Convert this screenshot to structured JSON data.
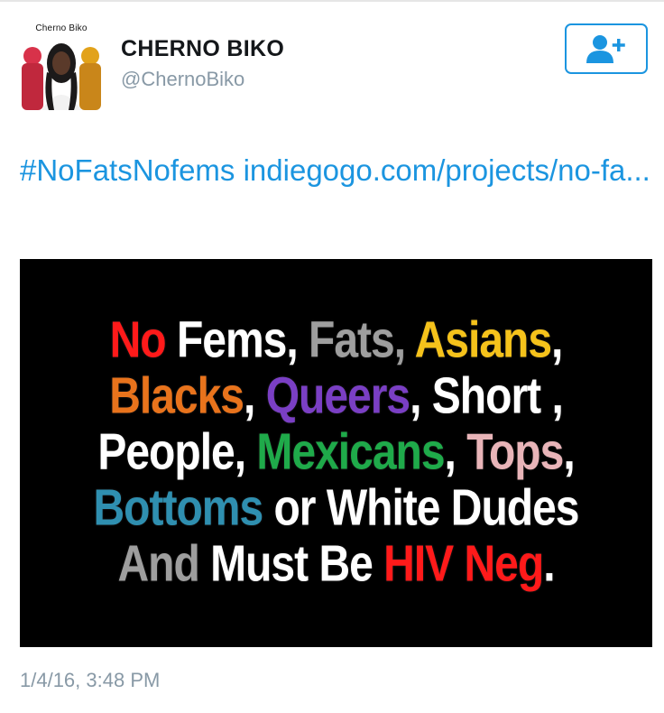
{
  "author": {
    "avatar_caption": "Cherno Biko",
    "display_name": "CHERNO BIKO",
    "handle": "@ChernoBiko"
  },
  "follow_icon": "add-user-icon",
  "tweet": {
    "hashtag": "#NoFatsNofems",
    "link": "indiegogo.com/projects/no-fa...",
    "timestamp": "1/4/16, 3:48 PM"
  },
  "media_text": {
    "line1": {
      "w1": "No",
      "w2": "Fems,",
      "w3": "Fats,",
      "w4": "Asians",
      "w5": ","
    },
    "line2": {
      "w1": "Blacks",
      "w2": ",",
      "w3": "Queers",
      "w4": ", Short ,"
    },
    "line3": {
      "w1": "People,",
      "w2": "Mexicans",
      "w3": ",",
      "w4": "Tops",
      "w5": ","
    },
    "line4": {
      "w1": "Bottoms",
      "w2": "or White Dudes"
    },
    "line5": {
      "w1": "And",
      "w2": "Must Be",
      "w3": "HIV Neg",
      "w4": "."
    }
  },
  "colors": {
    "link": "#1b95e0",
    "red": "#ff1a1a",
    "gray": "#9e9e9e",
    "yellow": "#f5c21b",
    "orange": "#e8731c",
    "purple": "#7a3fc4",
    "green": "#1faa4a",
    "pink": "#e8b4b8",
    "teal": "#2f8fb0"
  }
}
